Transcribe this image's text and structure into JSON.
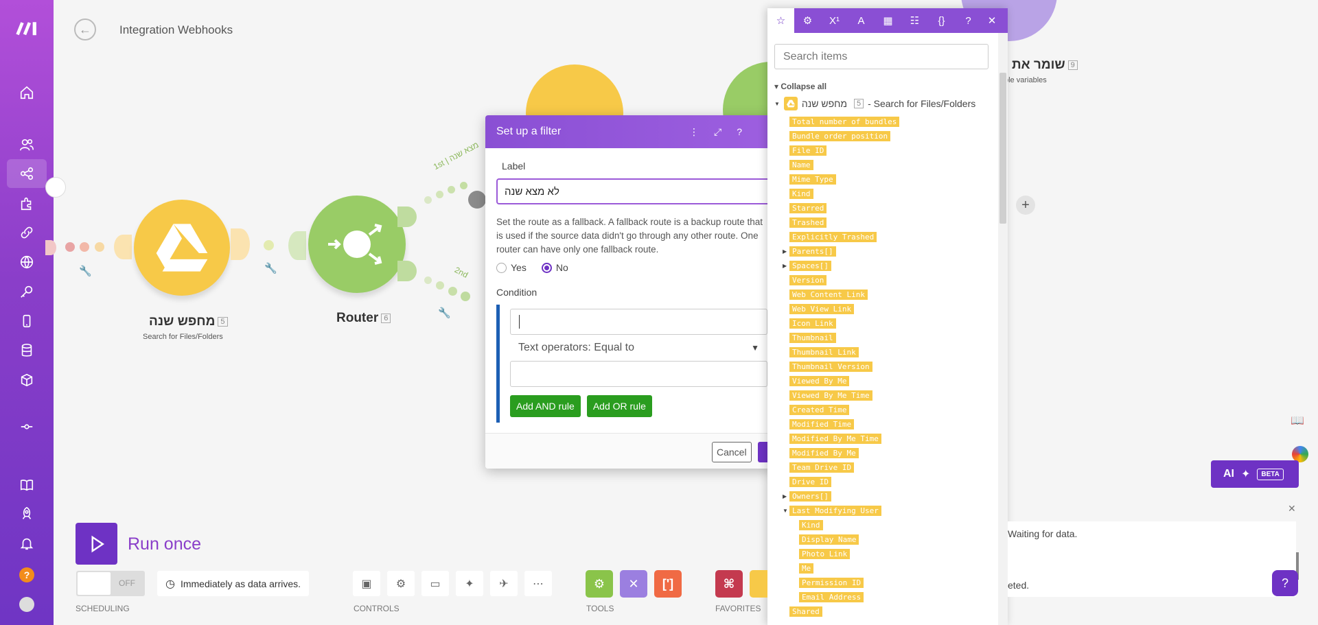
{
  "header": {
    "title": "Integration Webhooks"
  },
  "sidebar": {
    "items": [
      "logo",
      "home-icon",
      "team-icon",
      "share-icon",
      "puzzle-icon",
      "link-icon",
      "globe-icon",
      "key-icon",
      "mobile-icon",
      "database-icon",
      "cube-icon",
      "flow-icon",
      "book-icon",
      "rocket-icon",
      "bell-icon",
      "help-icon",
      "user-icon"
    ]
  },
  "nodes": {
    "search": {
      "name": "מחפש שנה",
      "num": "5",
      "sub": "Search for Files/Folders"
    },
    "router": {
      "name": "Router",
      "num": "6"
    },
    "save": {
      "name": "שומר את",
      "num": "9",
      "sub": "ple variables"
    },
    "route1_label": "1st | מצא שנה",
    "route2_label": "2nd"
  },
  "dialog": {
    "title": "Set up a filter",
    "label_caption": "Label",
    "label_value": "לא מצא שנה",
    "description": "Set the route as a fallback. A fallback route is a backup route that is used if the source data didn't go through any other route. One router can have only one fallback route.",
    "radio_yes": "Yes",
    "radio_no": "No",
    "fallback_selected": "No",
    "condition_caption": "Condition",
    "operator": "Text operators: Equal to",
    "add_and": "Add AND rule",
    "add_or": "Add OR rule",
    "cancel": "Cancel",
    "ok": "O"
  },
  "panel": {
    "tabs": [
      "star-icon",
      "gear-icon",
      "superscript-icon",
      "text-icon",
      "calendar-icon",
      "table-icon",
      "braces-icon",
      "help-icon",
      "close-icon"
    ],
    "search_placeholder": "Search items",
    "collapse_all": "Collapse all",
    "module_name": "מחפש שנה",
    "module_num": "5",
    "module_suffix": "- Search for Files/Folders",
    "items": [
      {
        "label": "Total number of bundles",
        "level": 0,
        "arrow": ""
      },
      {
        "label": "Bundle order position",
        "level": 0,
        "arrow": ""
      },
      {
        "label": "File ID",
        "level": 0,
        "arrow": ""
      },
      {
        "label": "Name",
        "level": 0,
        "arrow": ""
      },
      {
        "label": "Mime Type",
        "level": 0,
        "arrow": ""
      },
      {
        "label": "Kind",
        "level": 0,
        "arrow": ""
      },
      {
        "label": "Starred",
        "level": 0,
        "arrow": ""
      },
      {
        "label": "Trashed",
        "level": 0,
        "arrow": ""
      },
      {
        "label": "Explicitly Trashed",
        "level": 0,
        "arrow": ""
      },
      {
        "label": "Parents[]",
        "level": 0,
        "arrow": "right"
      },
      {
        "label": "Spaces[]",
        "level": 0,
        "arrow": "right"
      },
      {
        "label": "Version",
        "level": 0,
        "arrow": ""
      },
      {
        "label": "Web Content Link",
        "level": 0,
        "arrow": ""
      },
      {
        "label": "Web View Link",
        "level": 0,
        "arrow": ""
      },
      {
        "label": "Icon Link",
        "level": 0,
        "arrow": ""
      },
      {
        "label": "Thumbnail",
        "level": 0,
        "arrow": ""
      },
      {
        "label": "Thumbnail Link",
        "level": 0,
        "arrow": ""
      },
      {
        "label": "Thumbnail Version",
        "level": 0,
        "arrow": ""
      },
      {
        "label": "Viewed By Me",
        "level": 0,
        "arrow": ""
      },
      {
        "label": "Viewed By Me Time",
        "level": 0,
        "arrow": ""
      },
      {
        "label": "Created Time",
        "level": 0,
        "arrow": ""
      },
      {
        "label": "Modified Time",
        "level": 0,
        "arrow": ""
      },
      {
        "label": "Modified By Me Time",
        "level": 0,
        "arrow": ""
      },
      {
        "label": "Modified By Me",
        "level": 0,
        "arrow": ""
      },
      {
        "label": "Team Drive ID",
        "level": 0,
        "arrow": ""
      },
      {
        "label": "Drive ID",
        "level": 0,
        "arrow": ""
      },
      {
        "label": "Owners[]",
        "level": 0,
        "arrow": "right"
      },
      {
        "label": "Last Modifying User",
        "level": 0,
        "arrow": "down"
      },
      {
        "label": "Kind",
        "level": 1,
        "arrow": ""
      },
      {
        "label": "Display Name",
        "level": 1,
        "arrow": ""
      },
      {
        "label": "Photo Link",
        "level": 1,
        "arrow": ""
      },
      {
        "label": "Me",
        "level": 1,
        "arrow": ""
      },
      {
        "label": "Permission ID",
        "level": 1,
        "arrow": ""
      },
      {
        "label": "Email Address",
        "level": 1,
        "arrow": ""
      },
      {
        "label": "Shared",
        "level": 0,
        "arrow": ""
      }
    ]
  },
  "toolbar": {
    "run_once": "Run once",
    "toggle_state": "OFF",
    "schedule_text": "Immediately as data arrives.",
    "scheduling_label": "SCHEDULING",
    "controls_label": "CONTROLS",
    "tools_label": "TOOLS",
    "favorites_label": "FAVORITES"
  },
  "right": {
    "ai_label": "AI",
    "beta_label": "BETA",
    "log_line1": "Waiting for data.",
    "log_line2": "eted."
  },
  "colors": {
    "accent": "#6e32c4",
    "drive": "#f7c948",
    "router": "#99cc66",
    "green_btn": "#2a9d1f"
  }
}
